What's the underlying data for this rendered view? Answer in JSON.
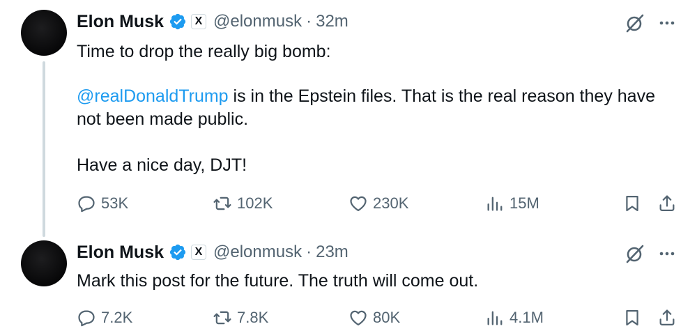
{
  "tweets": [
    {
      "author_name": "Elon Musk",
      "handle": "@elonmusk",
      "separator": "·",
      "time": "32m",
      "text_lines": [
        "Time to drop the really big bomb:"
      ],
      "mention": "@realDonaldTrump",
      "mention_rest_line1": " is in the Epstein files. That is the real reason they have",
      "line3": "not been made public.",
      "line4": "Have a nice day, DJT!",
      "replies": "53K",
      "reposts": "102K",
      "likes": "230K",
      "views": "15M"
    },
    {
      "author_name": "Elon Musk",
      "handle": "@elonmusk",
      "separator": "·",
      "time": "23m",
      "text": "Mark this post for the future. The truth will come out.",
      "replies": "7.2K",
      "reposts": "7.8K",
      "likes": "80K",
      "views": "4.1M"
    }
  ],
  "badge_letter": "X",
  "colors": {
    "text": "#0f1419",
    "secondary": "#536471",
    "link": "#1d9bf0",
    "verified": "#1d9bf0",
    "thread_line": "#cfd9de"
  },
  "icons": [
    "verified-badge-icon",
    "x-affiliate-icon",
    "grok-icon",
    "more-icon",
    "reply-icon",
    "repost-icon",
    "like-icon",
    "views-icon",
    "bookmark-icon",
    "share-icon"
  ]
}
